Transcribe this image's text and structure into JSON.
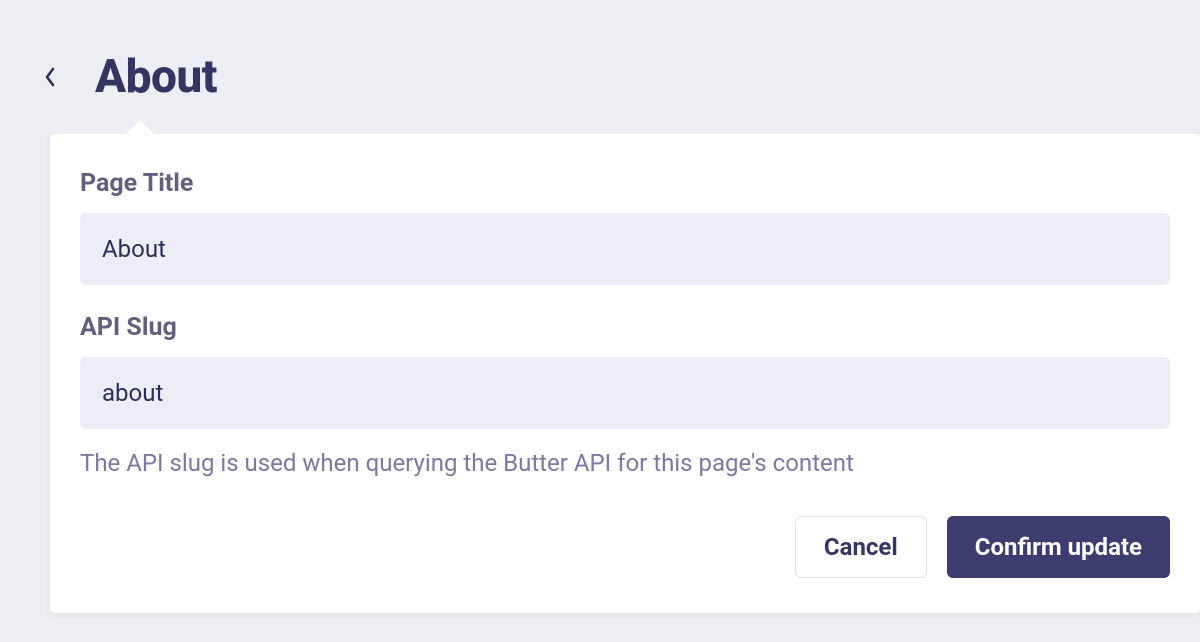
{
  "header": {
    "title": "About"
  },
  "form": {
    "page_title": {
      "label": "Page Title",
      "value": "About"
    },
    "api_slug": {
      "label": "API Slug",
      "value": "about",
      "help_text": "The API slug is used when querying the Butter API for this page's content"
    }
  },
  "actions": {
    "cancel_label": "Cancel",
    "confirm_label": "Confirm update"
  }
}
